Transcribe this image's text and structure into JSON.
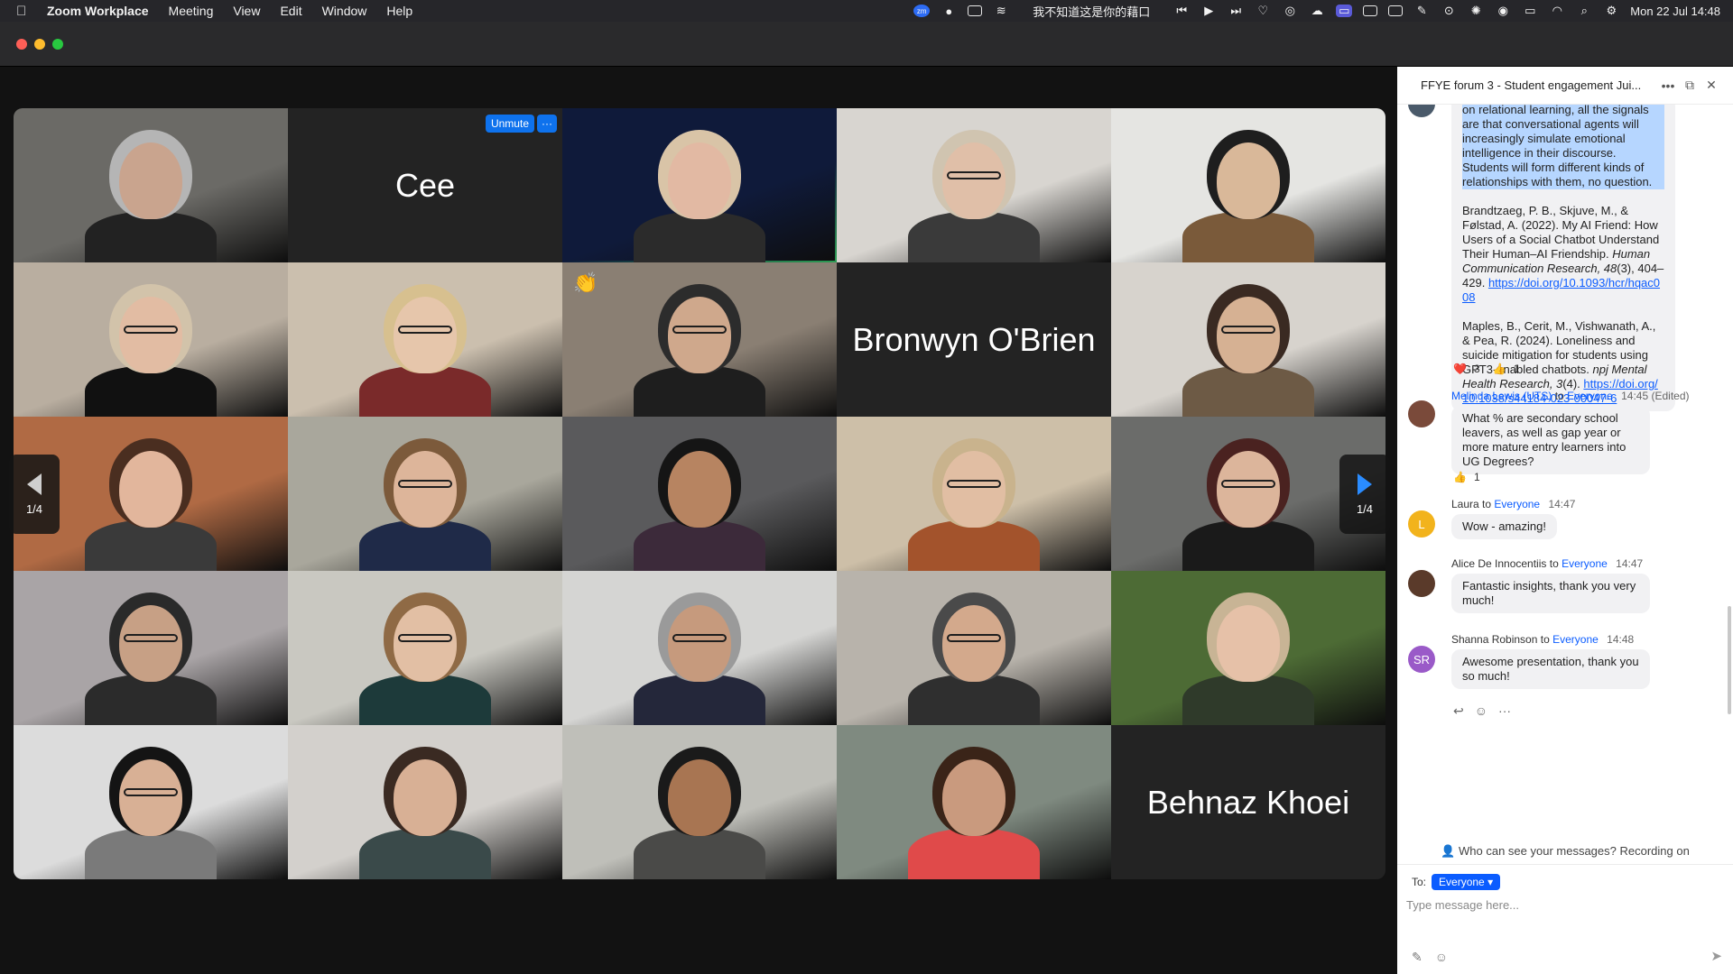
{
  "menubar": {
    "app_name": "Zoom Workplace",
    "items": [
      "Meeting",
      "View",
      "Edit",
      "Window",
      "Help"
    ],
    "center_text": "我不知道这是你的藉口",
    "datetime": "Mon 22 Jul  14:48"
  },
  "meeting": {
    "tiles": [
      {
        "kind": "video",
        "bg": "#6b6a66",
        "skin": "#c9a48e",
        "hair": "#b5b5b5",
        "shirt": "#222222",
        "glasses": false
      },
      {
        "kind": "name",
        "name": "Cee",
        "unmute_label": "Unmute",
        "more_label": "···"
      },
      {
        "kind": "video",
        "bg": "#0f1a3a",
        "skin": "#e2b9a3",
        "hair": "#d9c4a7",
        "shirt": "#2b2b2b",
        "glasses": false,
        "speaking": true
      },
      {
        "kind": "video",
        "bg": "#d8d5d0",
        "skin": "#e0bfa8",
        "hair": "#d0c4b0",
        "shirt": "#3a3a3a",
        "glasses": true
      },
      {
        "kind": "video",
        "bg": "#e5e5e2",
        "skin": "#d9b899",
        "hair": "#1e1e1e",
        "shirt": "#7a5a3a",
        "glasses": false
      },
      {
        "kind": "video",
        "bg": "#b9aea0",
        "skin": "#e2bca3",
        "hair": "#d2c3aa",
        "shirt": "#111111",
        "glasses": true
      },
      {
        "kind": "video",
        "bg": "#cbbfae",
        "skin": "#e6c6ab",
        "hair": "#d7c08f",
        "shirt": "#7a2a2a",
        "glasses": true
      },
      {
        "kind": "video",
        "bg": "#8a7f73",
        "skin": "#cfa88c",
        "hair": "#2c2c2c",
        "shirt": "#1e1e1e",
        "glasses": true,
        "wave": "👏"
      },
      {
        "kind": "name",
        "name": "Bronwyn O'Brien"
      },
      {
        "kind": "video",
        "bg": "#d7d3cd",
        "skin": "#d6b193",
        "hair": "#3a2a22",
        "shirt": "#6d5a45",
        "glasses": true
      },
      {
        "kind": "video",
        "bg": "#b06a44",
        "skin": "#e2b69c",
        "hair": "#4a2e20",
        "shirt": "#3a3a3a",
        "glasses": false
      },
      {
        "kind": "video",
        "bg": "#a9a79c",
        "skin": "#ddb59a",
        "hair": "#7c5a3b",
        "shirt": "#1f2a48",
        "glasses": true
      },
      {
        "kind": "video",
        "bg": "#5a5a5c",
        "skin": "#b78461",
        "hair": "#151515",
        "shirt": "#3c2a3a",
        "glasses": false
      },
      {
        "kind": "video",
        "bg": "#cdbfa8",
        "skin": "#e1bea3",
        "hair": "#c9b38d",
        "shirt": "#a3532c",
        "glasses": true
      },
      {
        "kind": "video",
        "bg": "#6b6c6a",
        "skin": "#dcb59b",
        "hair": "#4a2220",
        "shirt": "#1a1a1a",
        "glasses": true
      },
      {
        "kind": "video",
        "bg": "#a9a4a6",
        "skin": "#c7a085",
        "hair": "#2a2a2a",
        "shirt": "#2b2b2b",
        "glasses": true
      },
      {
        "kind": "video",
        "bg": "#c9c8c1",
        "skin": "#e2bfa4",
        "hair": "#8f6a45",
        "shirt": "#1d3a3a",
        "glasses": true
      },
      {
        "kind": "video",
        "bg": "#d5d5d3",
        "skin": "#c69a7d",
        "hair": "#9a9a9a",
        "shirt": "#24273a",
        "glasses": true
      },
      {
        "kind": "video",
        "bg": "#b8b3ab",
        "skin": "#d3a98c",
        "hair": "#4a4a4a",
        "shirt": "#2f2f2f",
        "glasses": true
      },
      {
        "kind": "video",
        "bg": "#4d6b35",
        "skin": "#e6c1a8",
        "hair": "#c8b495",
        "shirt": "#2f3a2a",
        "glasses": false
      },
      {
        "kind": "video",
        "bg": "#dcdcdc",
        "skin": "#d8b095",
        "hair": "#141414",
        "shirt": "#7a7a7a",
        "glasses": true
      },
      {
        "kind": "video",
        "bg": "#d3d0cc",
        "skin": "#d8b095",
        "hair": "#3a2a22",
        "shirt": "#3a4a4a",
        "glasses": false
      },
      {
        "kind": "video",
        "bg": "#bfbfb9",
        "skin": "#a87552",
        "hair": "#1a1a1a",
        "shirt": "#4a4a48",
        "glasses": false
      },
      {
        "kind": "video",
        "bg": "#7f8a80",
        "skin": "#c99a7e",
        "hair": "#3a2418",
        "shirt": "#e04a4a",
        "glasses": false
      },
      {
        "kind": "name",
        "name": "Behnaz Khoei"
      }
    ],
    "pager_label": "1/4"
  },
  "chat": {
    "title": "FFYE forum 3 - Student engagement Jui...",
    "first_message": {
      "lines_selected": "on relational learning, all the signals are that conversational agents will increasingly simulate emotional intelligence in their discourse. Students will form different kinds of relationships with them, no question.",
      "ref1_plain": "Brandtzaeg, P. B., Skjuve, M., & Følstad, A. (2022). My AI Friend: How Users of a Social Chatbot Understand Their Human–AI Friendship.",
      "ref1_journal": "Human Communication Research, 48",
      "ref1_rest": "(3), 404–429.",
      "ref1_link": "https://doi.org/10.1093/hcr/hqac008",
      "ref2_plain": "Maples, B., Cerit, M., Vishwanath, A., & Pea, R. (2024). Loneliness and suicide mitigation for students using GPT3-enabled chatbots.",
      "ref2_journal": "npj Mental Health Research, 3",
      "ref2_rest": "(4).",
      "ref2_link": "https://doi.org/10.1038/s44184-023-00047-6",
      "reactions": [
        {
          "emoji": "❤️",
          "count": "3"
        },
        {
          "emoji": "👍",
          "count": "1"
        }
      ]
    },
    "messages": [
      {
        "sender": "Melinda Lewis (UTS)",
        "to_word": "to",
        "recipient": "Everyone",
        "time": "14:45 (Edited)",
        "text": "What % are secondary school leavers, as well as gap year or more mature entry learners into UG Degrees?",
        "reaction_emoji": "👍",
        "reaction_count": "1",
        "avatar_text": "",
        "avatar_color": "#7a4a3a"
      },
      {
        "sender": "Laura",
        "to_word": "to",
        "recipient": "Everyone",
        "time": "14:47",
        "text": "Wow - amazing!",
        "avatar_text": "L",
        "avatar_color": "#f2b31c"
      },
      {
        "sender": "Alice De Innocentiis",
        "to_word": "to",
        "recipient": "Everyone",
        "time": "14:47",
        "text": "Fantastic insights, thank you very much!",
        "avatar_text": "",
        "avatar_color": "#5a3a2a"
      },
      {
        "sender": "Shanna Robinson",
        "to_word": "to",
        "recipient": "Everyone",
        "time": "14:48",
        "text": "Awesome presentation, thank you so much!",
        "avatar_text": "SR",
        "avatar_color": "#9a5ac8"
      }
    ],
    "visibility_text": "Who can see your messages? Recording on",
    "to_label": "To:",
    "to_value": "Everyone",
    "input_placeholder": "Type message here..."
  }
}
